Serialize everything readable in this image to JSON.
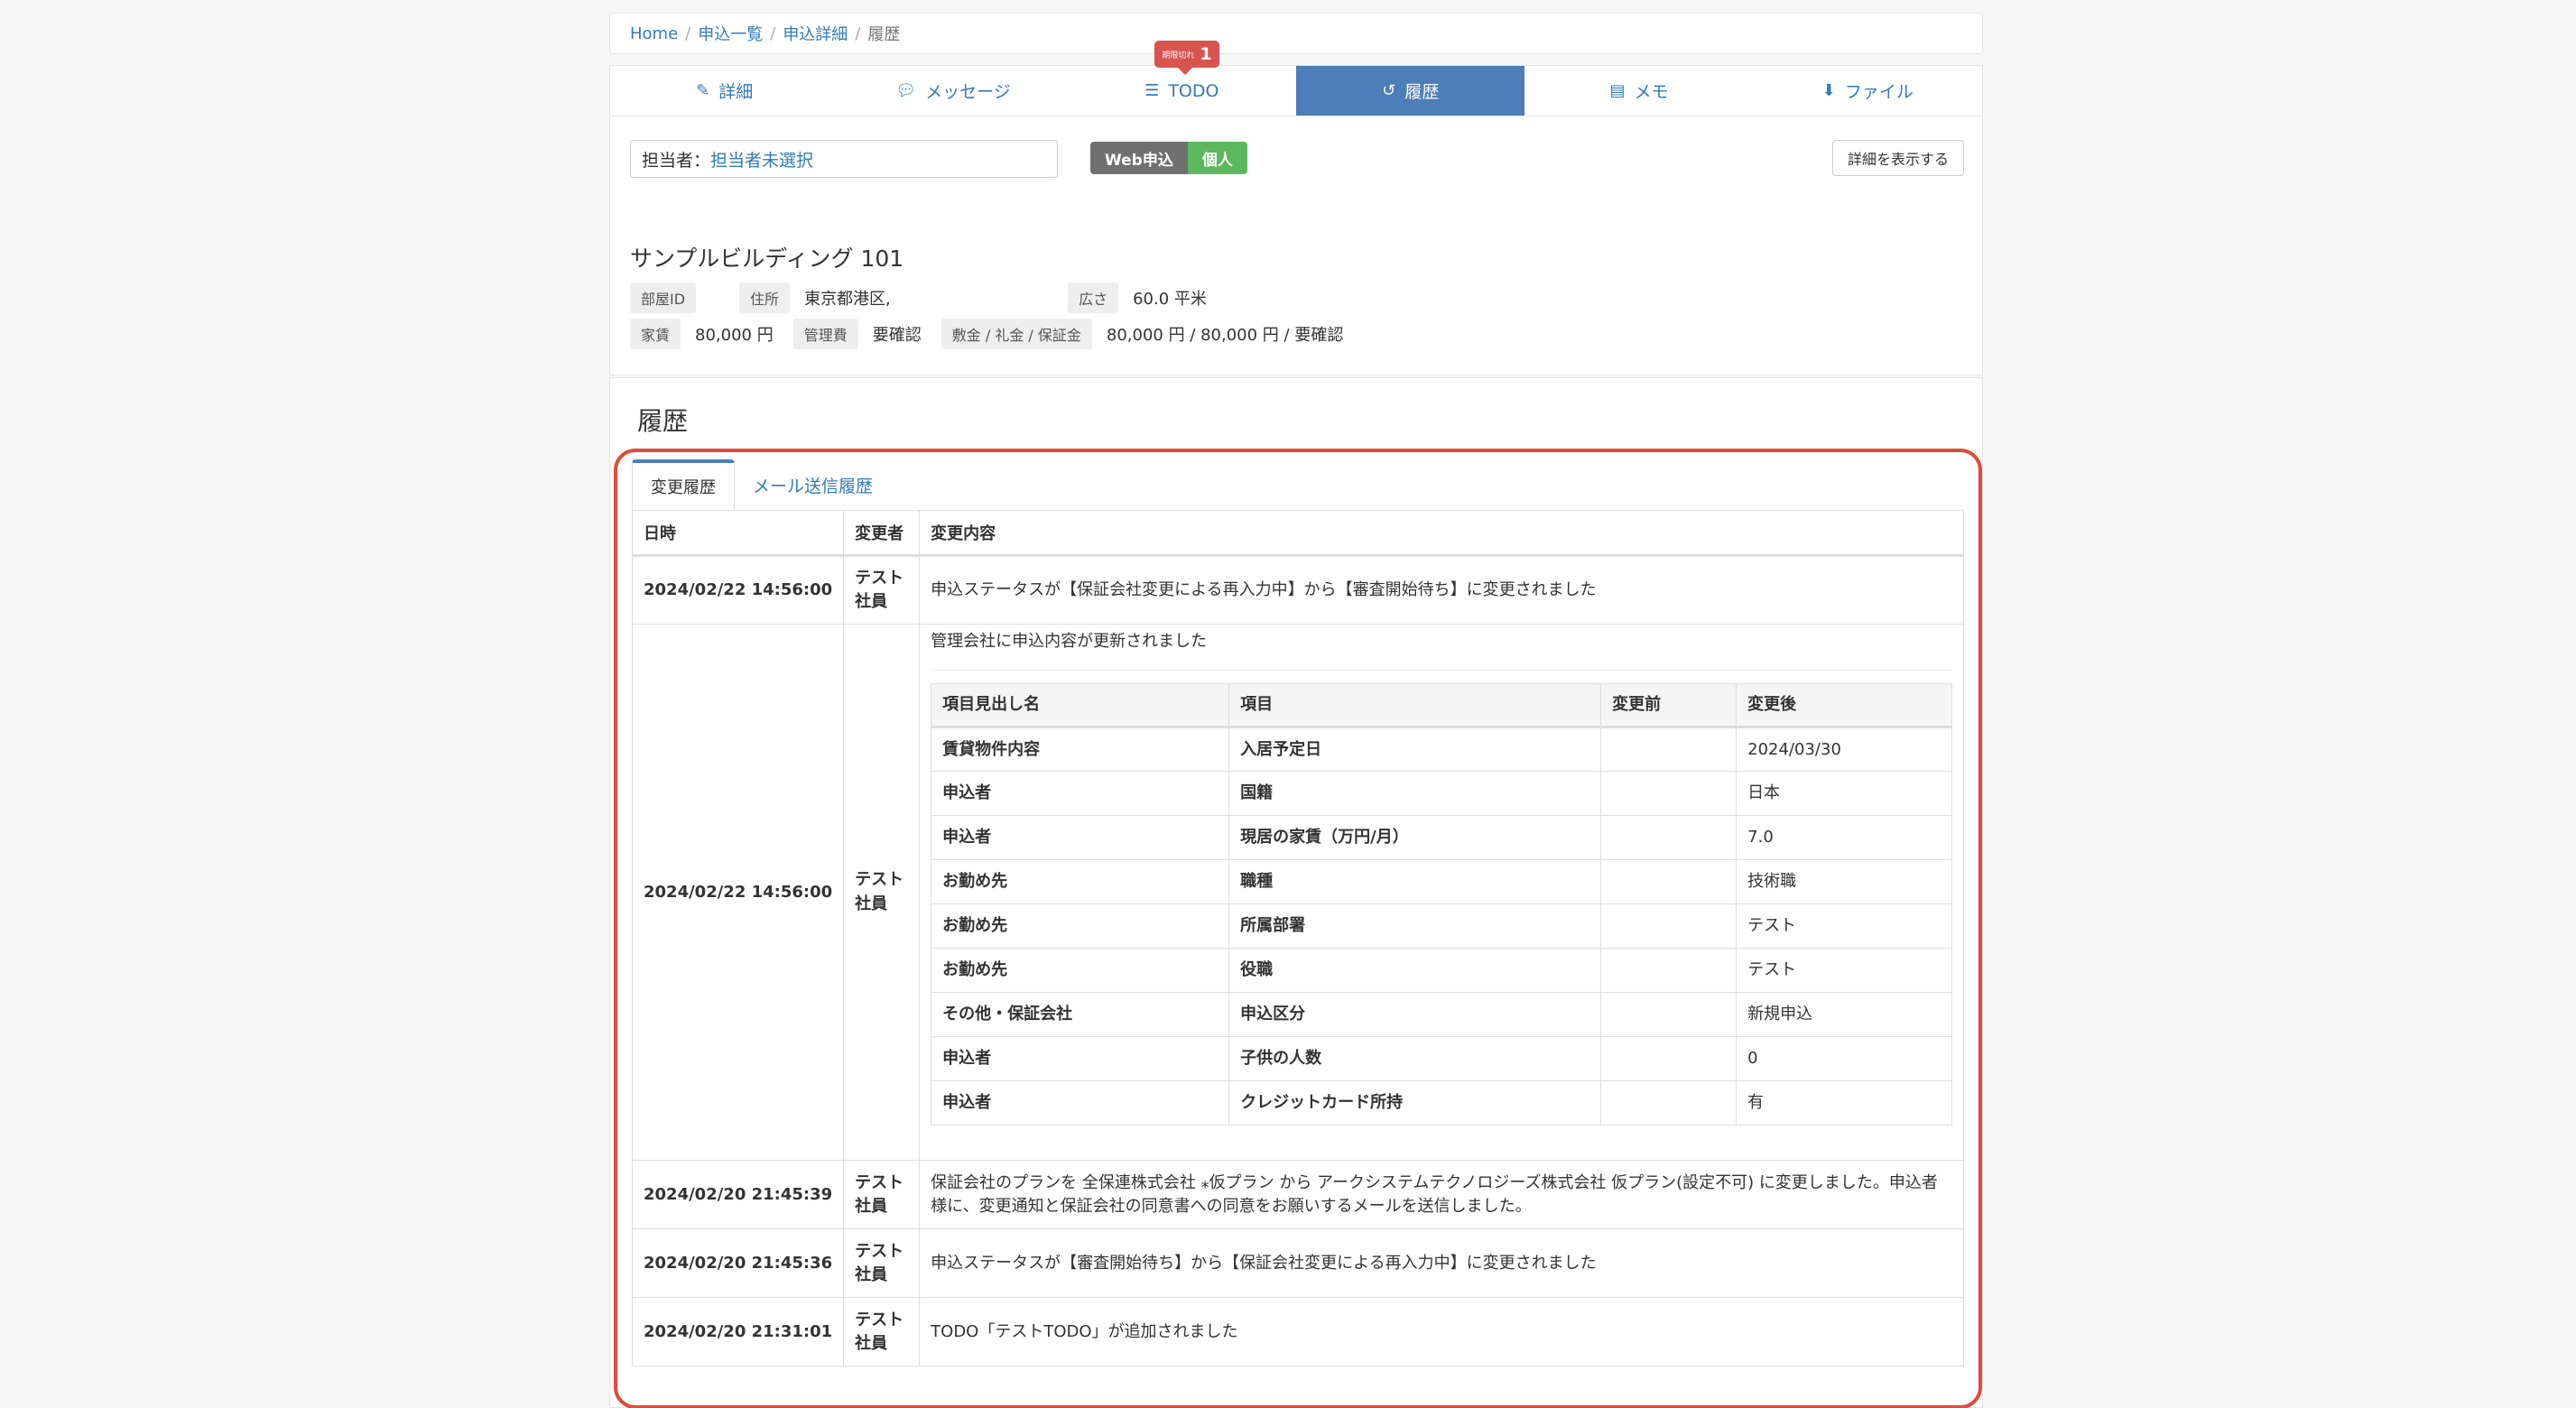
{
  "breadcrumb": {
    "home": "Home",
    "list": "申込一覧",
    "detail": "申込詳細",
    "current": "履歴"
  },
  "tabs": [
    {
      "label": "詳細",
      "icon": "edit-icon"
    },
    {
      "label": "メッセージ",
      "icon": "comments-icon"
    },
    {
      "label": "TODO",
      "icon": "list-icon",
      "badge_text": "期限切れ",
      "badge_count": "1"
    },
    {
      "label": "履歴",
      "icon": "history-icon",
      "active": true
    },
    {
      "label": "メモ",
      "icon": "memo-icon"
    },
    {
      "label": "ファイル",
      "icon": "download-icon"
    }
  ],
  "assignee": {
    "label": "担当者：",
    "value": "担当者未選択"
  },
  "badges": {
    "channel": "Web申込",
    "type": "個人"
  },
  "detail_button": "詳細を表示する",
  "property": {
    "name": "サンプルビルディング 101",
    "room_id_label": "部屋ID",
    "address_label": "住所",
    "address": "東京都港区,",
    "area_label": "広さ",
    "area": "60.0 平米",
    "rent_label": "家賃",
    "rent": "80,000 円",
    "mgmt_label": "管理費",
    "mgmt": "要確認",
    "deposit_label": "敷金 / 礼金 / 保証金",
    "deposit": "80,000 円 / 80,000 円 / 要確認"
  },
  "history": {
    "title": "履歴",
    "subtabs": {
      "changes": "変更履歴",
      "mail": "メール送信履歴"
    },
    "headers": {
      "date": "日時",
      "user": "変更者",
      "content": "変更内容"
    },
    "row1": {
      "date": "2024/02/22 14:56:00",
      "user": "テスト社員",
      "content": "申込ステータスが【保証会社変更による再入力中】から【審査開始待ち】に変更されました"
    },
    "row2": {
      "date": "2024/02/22 14:56:00",
      "user": "テスト社員",
      "content": "管理会社に申込内容が更新されました",
      "inner_headers": {
        "heading": "項目見出し名",
        "item": "項目",
        "before": "変更前",
        "after": "変更後"
      },
      "inner_rows": [
        {
          "heading": "賃貸物件内容",
          "item": "入居予定日",
          "before": "",
          "after": "2024/03/30"
        },
        {
          "heading": "申込者",
          "item": "国籍",
          "before": "",
          "after": "日本"
        },
        {
          "heading": "申込者",
          "item": "現居の家賃（万円/月）",
          "before": "",
          "after": "7.0"
        },
        {
          "heading": "お勤め先",
          "item": "職種",
          "before": "",
          "after": "技術職"
        },
        {
          "heading": "お勤め先",
          "item": "所属部署",
          "before": "",
          "after": "テスト"
        },
        {
          "heading": "お勤め先",
          "item": "役職",
          "before": "",
          "after": "テスト"
        },
        {
          "heading": "その他・保証会社",
          "item": "申込区分",
          "before": "",
          "after": "新規申込"
        },
        {
          "heading": "申込者",
          "item": "子供の人数",
          "before": "",
          "after": "0"
        },
        {
          "heading": "申込者",
          "item": "クレジットカード所持",
          "before": "",
          "after": "有"
        }
      ]
    },
    "row3": {
      "date": "2024/02/20 21:45:39",
      "user": "テスト社員",
      "content": "保証会社のプランを 全保連株式会社 ⁎仮プラン から アークシステムテクノロジーズ株式会社 仮プラン(設定不可) に変更しました。申込者様に、変更通知と保証会社の同意書への同意をお願いするメールを送信しました。"
    },
    "row4": {
      "date": "2024/02/20 21:45:36",
      "user": "テスト社員",
      "content": "申込ステータスが【審査開始待ち】から【保証会社変更による再入力中】に変更されました"
    },
    "row5": {
      "date": "2024/02/20 21:31:01",
      "user": "テスト社員",
      "content": "TODO「テストTODO」が追加されました"
    }
  }
}
